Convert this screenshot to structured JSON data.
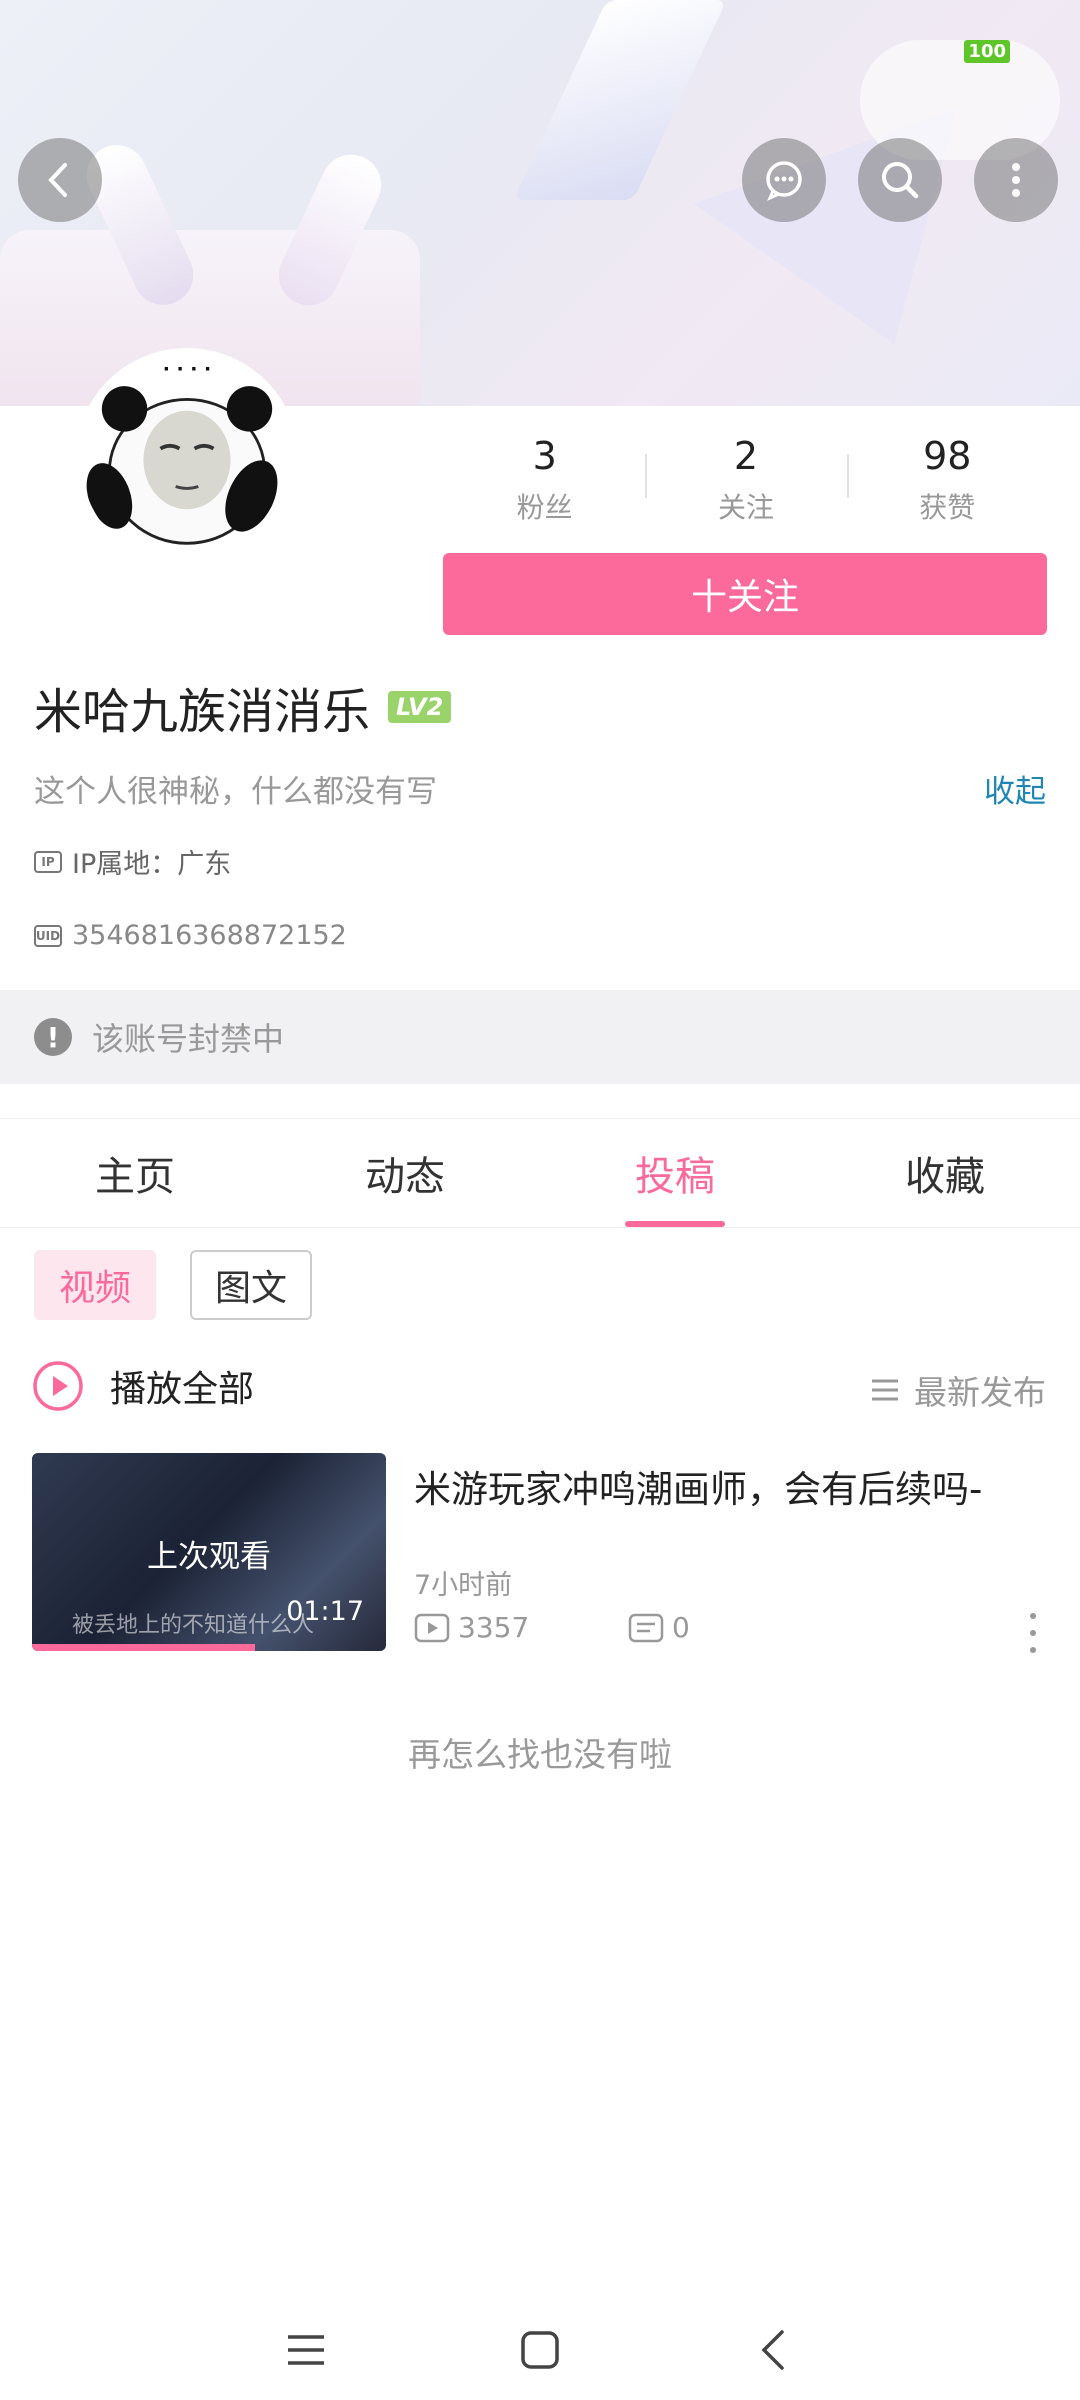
{
  "status": {
    "battery": "100"
  },
  "stats": [
    {
      "value": "3",
      "label": "粉丝"
    },
    {
      "value": "2",
      "label": "关注"
    },
    {
      "value": "98",
      "label": "获赞"
    }
  ],
  "follow_button": "十关注",
  "profile": {
    "name": "米哈九族消消乐",
    "level": "LV2",
    "bio": "这个人很神秘，什么都没有写",
    "collapse": "收起",
    "ip_location": "IP属地：广东",
    "uid": "3546816368872152",
    "banned_notice": "该账号封禁中"
  },
  "tabs": [
    "主页",
    "动态",
    "投稿",
    "收藏"
  ],
  "active_tab": "投稿",
  "filters": [
    "视频",
    "图文"
  ],
  "play_all": "播放全部",
  "sort": "最新发布",
  "video": {
    "title": "米游玩家冲鸣潮画师，会有后续吗-",
    "thumb_overlay": "上次观看",
    "thumb_subtitle": "被丢地上的不知道什么人",
    "duration": "01:17",
    "watch_progress": 0.63,
    "time": "7小时前",
    "views": "3357",
    "comments": "0"
  },
  "no_more": "再怎么找也没有啦",
  "colors": {
    "accent": "#fb6a9a",
    "link": "#1f86b6",
    "level": "#9ad36a"
  }
}
